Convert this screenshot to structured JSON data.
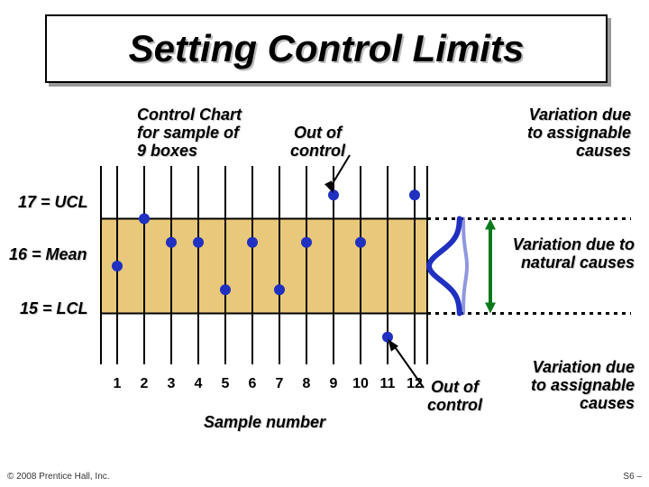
{
  "title": "Setting Control Limits",
  "labels": {
    "chart_caption": "Control Chart\nfor sample of\n9 boxes",
    "out_of_control": "Out of\ncontrol",
    "assignable_top": "Variation due\nto assignable\ncauses",
    "natural": "Variation due to\nnatural causes",
    "assignable_bottom": "Variation due\nto assignable\ncauses",
    "out_of_control_bottom": "Out of\ncontrol",
    "ucl": "17 = UCL",
    "mean": "16 = Mean",
    "lcl": "15 = LCL",
    "xaxis": "Sample number"
  },
  "footer": {
    "copyright": "© 2008 Prentice Hall, Inc.",
    "page": "S6 –"
  },
  "chart_data": {
    "type": "scatter",
    "title": "Control Chart for sample of 9 boxes",
    "xlabel": "Sample number",
    "ylabel": "",
    "x": [
      1,
      2,
      3,
      4,
      5,
      6,
      7,
      8,
      9,
      10,
      11,
      12
    ],
    "values": [
      16.0,
      17.0,
      16.5,
      16.5,
      15.5,
      16.5,
      15.5,
      16.5,
      17.5,
      16.5,
      14.5,
      17.5
    ],
    "ucl": 17,
    "mean": 16,
    "lcl": 15,
    "ylim": [
      14,
      18
    ],
    "xlim": [
      1,
      12
    ]
  }
}
